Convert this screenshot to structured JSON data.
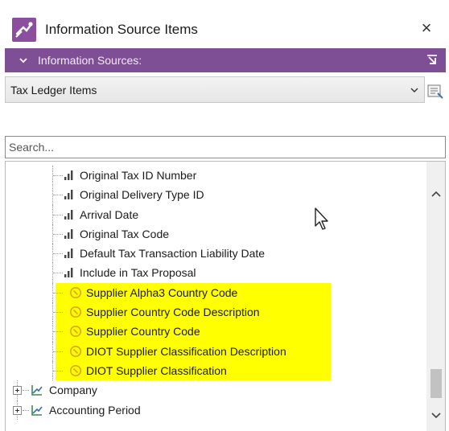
{
  "window": {
    "title": "Information Source Items",
    "close_label": "×"
  },
  "section": {
    "label": "Information Sources:"
  },
  "combo": {
    "selected": "Tax Ledger Items"
  },
  "search": {
    "placeholder": "Search..."
  },
  "tree": {
    "children": [
      {
        "label": "Original Tax ID Number",
        "icon": "field-icon",
        "highlighted": false
      },
      {
        "label": "Original Delivery Type ID",
        "icon": "field-icon",
        "highlighted": false
      },
      {
        "label": "Arrival Date",
        "icon": "field-icon",
        "highlighted": false
      },
      {
        "label": "Original Tax Code",
        "icon": "field-icon",
        "highlighted": false
      },
      {
        "label": "Default Tax Transaction Liability Date",
        "icon": "field-icon",
        "highlighted": false
      },
      {
        "label": "Include in Tax Proposal",
        "icon": "field-icon",
        "highlighted": false
      },
      {
        "label": "Supplier Alpha3 Country Code",
        "icon": "calculated-field-icon",
        "highlighted": true
      },
      {
        "label": "Supplier Country Code Description",
        "icon": "calculated-field-icon",
        "highlighted": true
      },
      {
        "label": "Supplier Country Code",
        "icon": "calculated-field-icon",
        "highlighted": true
      },
      {
        "label": "DIOT Supplier Classification Description",
        "icon": "calculated-field-icon",
        "highlighted": true
      },
      {
        "label": "DIOT Supplier Classification",
        "icon": "calculated-field-icon",
        "highlighted": true
      }
    ],
    "top_level": [
      {
        "label": "Company",
        "icon": "dimension-icon"
      },
      {
        "label": "Accounting Period",
        "icon": "dimension-icon"
      }
    ]
  },
  "colors": {
    "section_bar": "#7f4f95",
    "highlight": "#ffff00",
    "calculated_icon": "#e0a400"
  }
}
